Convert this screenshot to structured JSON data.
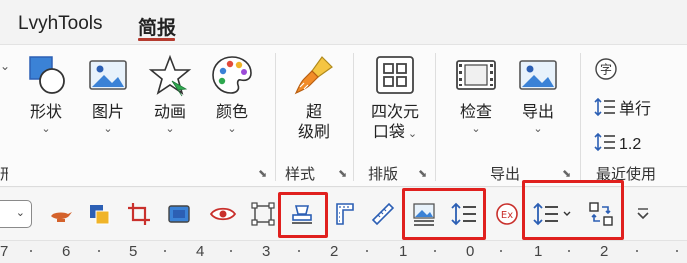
{
  "tabs": [
    {
      "label": "LvyhTools",
      "active": false
    },
    {
      "label": "简报",
      "active": true
    }
  ],
  "ribbon": {
    "buttons": {
      "shape": {
        "line1": "形状",
        "icon": "shape-icon"
      },
      "image": {
        "line1": "图片",
        "icon": "image-icon"
      },
      "animation": {
        "line1": "动画",
        "icon": "star-animation-icon"
      },
      "color": {
        "line1": "颜色",
        "icon": "palette-icon"
      },
      "super_brush": {
        "line1": "超",
        "line2": "级刷",
        "icon": "brush-icon"
      },
      "four_pocket": {
        "line1": "四次元",
        "line2": "口袋",
        "icon": "grid-pocket-icon"
      },
      "check": {
        "line1": "检查",
        "icon": "film-check-icon"
      },
      "export": {
        "line1": "导出",
        "icon": "export-image-icon"
      }
    },
    "groups": {
      "style": "样式",
      "layout": "排版",
      "export": "导出",
      "recent": "最近使用"
    },
    "side": {
      "font_icon": "字",
      "line_spacing_single": "单行",
      "line_spacing_value": "1.2"
    }
  },
  "ruler": {
    "labels": [
      "7",
      "6",
      "5",
      "4",
      "3",
      "2",
      "1",
      "0",
      "1",
      "2"
    ]
  },
  "colors": {
    "accent": "#b43a2e",
    "highlight": "#e0201e",
    "blue_icon": "#2c5fb4",
    "red_icon": "#c9302c"
  }
}
